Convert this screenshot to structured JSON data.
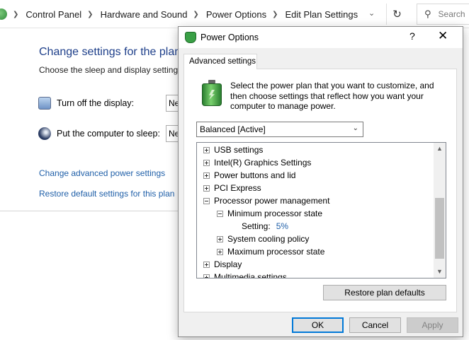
{
  "breadcrumbs": [
    "Control Panel",
    "Hardware and Sound",
    "Power Options",
    "Edit Plan Settings"
  ],
  "search": {
    "placeholder": "Search"
  },
  "control_panel": {
    "heading": "Change settings for the plan",
    "subheading": "Choose the sleep and display settings",
    "display_label": "Turn off the display:",
    "sleep_label": "Put the computer to sleep:",
    "display_value": "Ne",
    "sleep_value": "Ne",
    "advanced_link": "Change advanced power settings",
    "restore_link": "Restore default settings for this plan"
  },
  "dialog": {
    "title": "Power Options",
    "help_label": "?",
    "close_label": "✕",
    "tab_label": "Advanced settings",
    "description": "Select the power plan that you want to customize, and then choose settings that reflect how you want your computer to manage power.",
    "plan_selected": "Balanced [Active]",
    "tree": [
      {
        "label": "USB settings",
        "indent": 0,
        "state": "collapsed"
      },
      {
        "label": "Intel(R) Graphics Settings",
        "indent": 0,
        "state": "collapsed"
      },
      {
        "label": "Power buttons and lid",
        "indent": 0,
        "state": "collapsed"
      },
      {
        "label": "PCI Express",
        "indent": 0,
        "state": "collapsed"
      },
      {
        "label": "Processor power management",
        "indent": 0,
        "state": "expanded"
      },
      {
        "label": "Minimum processor state",
        "indent": 1,
        "state": "expanded"
      },
      {
        "label": "Setting:",
        "indent": 2,
        "state": "leaf",
        "value": "5%"
      },
      {
        "label": "System cooling policy",
        "indent": 1,
        "state": "collapsed"
      },
      {
        "label": "Maximum processor state",
        "indent": 1,
        "state": "collapsed"
      },
      {
        "label": "Display",
        "indent": 0,
        "state": "collapsed"
      },
      {
        "label": "Multimedia settings",
        "indent": 0,
        "state": "collapsed"
      }
    ],
    "restore_button": "Restore plan defaults",
    "ok_button": "OK",
    "cancel_button": "Cancel",
    "apply_button": "Apply"
  }
}
